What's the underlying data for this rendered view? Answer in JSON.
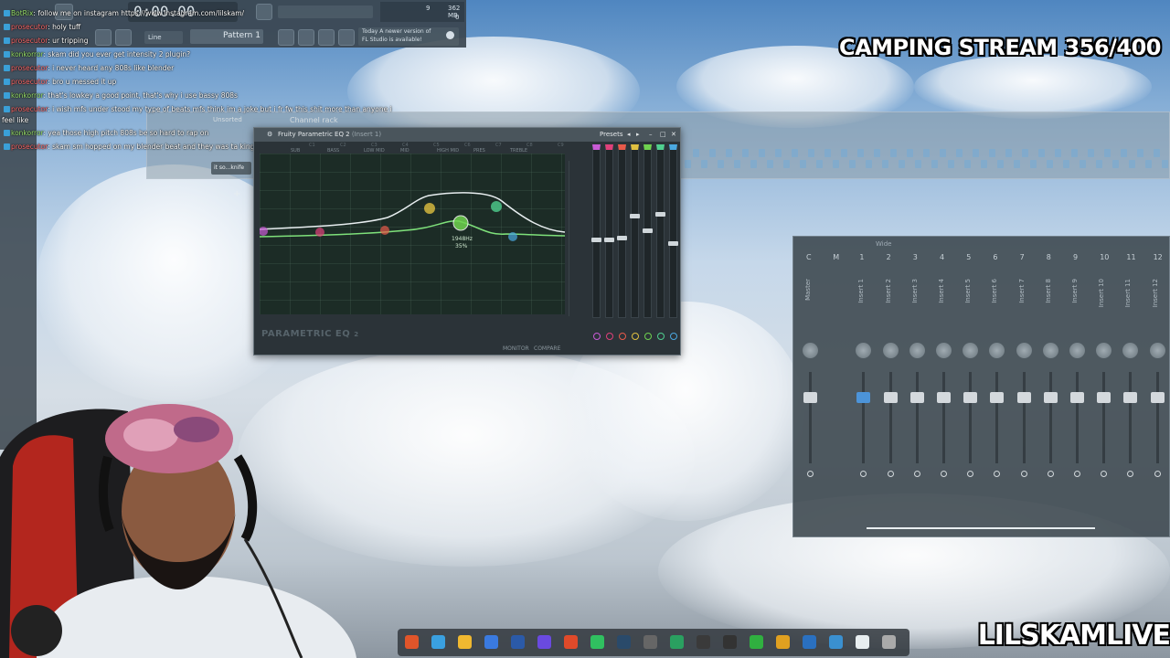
{
  "stream_overlay": {
    "title": "CAMPING STREAM 356/400",
    "channel": "LILSKAMLIVE"
  },
  "fl_toolbar": {
    "time": "0:00.00",
    "memory": "362 MB",
    "cpu_count": "9",
    "voices": "0",
    "snap": "Line",
    "pattern": "Pattern 1",
    "hint_line1": "Today  A newer version of",
    "hint_line2": "FL Studio is available!"
  },
  "chat": [
    {
      "user": "BotRix",
      "text": "follow me on instagram https://www.instagram.com/lilskam/",
      "color": "green"
    },
    {
      "user": "prosecutor",
      "text": "holy tuff",
      "color": "red"
    },
    {
      "user": "prosecutor",
      "text": "ur tripping",
      "color": "red"
    },
    {
      "user": "konkorror",
      "text": "skam did you ever get intensity 2 plugin?",
      "color": "green"
    },
    {
      "user": "prosecutor",
      "text": "i never heard any 808s like blender",
      "color": "red"
    },
    {
      "user": "prosecutor",
      "text": "bro u messed it up",
      "color": "red"
    },
    {
      "user": "konkorror",
      "text": "that's lowkey a good point, that's why i use bassy 808s",
      "color": "green"
    },
    {
      "user": "prosecutor",
      "text": "i wish mfs under stood my type of beats mfs think im a joke but i fr fw this shit more than anyone i",
      "color": "red"
    },
    {
      "user": "",
      "text": "feel like",
      "color": "none"
    },
    {
      "user": "konkorror",
      "text": "yea those high pitch 808s be so hard to rap on",
      "color": "green"
    },
    {
      "user": "prosecutor",
      "text": "skam sm hopped on my blender beat and they was ta king normal tho",
      "color": "red"
    }
  ],
  "channel_rack": {
    "title": "Channel rack",
    "filter": "Unsorted",
    "channel": "it so...knife"
  },
  "eq": {
    "title": "Fruity Parametric EQ 2",
    "insert": "(Insert 1)",
    "presets": "Presets",
    "freq_readout": "1948Hz",
    "gain_readout": "35%",
    "logo": "PARAMETRIC EQ",
    "logo_version": "2",
    "monitor": "MONITOR",
    "compare": "COMPARE",
    "top_labels": [
      "SUB",
      "BASS",
      "LOW MID",
      "MID",
      "HIGH MID",
      "PRES",
      "TREBLE"
    ],
    "note_labels": [
      "C1",
      "C2",
      "C3",
      "C4",
      "C5",
      "C6",
      "C7",
      "C8",
      "C9"
    ],
    "band_colors": [
      "#c95bd6",
      "#e0407a",
      "#e85a4a",
      "#e0c040",
      "#6fd24f",
      "#4fcf8f",
      "#4aa8e0"
    ]
  },
  "mixer": {
    "title": "Wide",
    "tracks": [
      "Master",
      "Insert 1",
      "Insert 2",
      "Insert 3",
      "Insert 4",
      "Insert 5",
      "Insert 6",
      "Insert 7",
      "Insert 8",
      "Insert 9",
      "Insert 10",
      "Insert 11",
      "Insert 12"
    ],
    "numbers": [
      "C",
      "M",
      "1",
      "2",
      "3",
      "4",
      "5",
      "6",
      "7",
      "8",
      "9",
      "10",
      "11",
      "12"
    ]
  }
}
